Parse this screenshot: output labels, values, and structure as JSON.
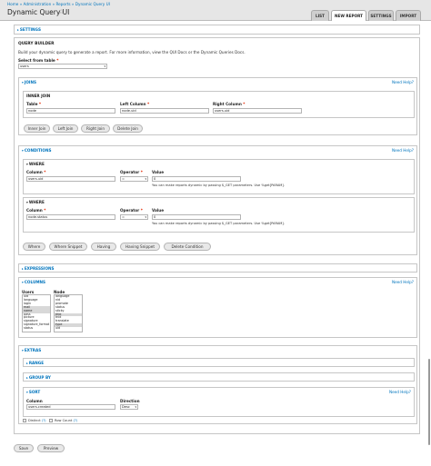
{
  "header": {
    "breadcrumb": "Home » Administration » Reports » Dynamic Query UI",
    "title": "Dynamic Query UI",
    "tabs": [
      "LIST",
      "NEW REPORT",
      "SETTINGS",
      "IMPORT"
    ]
  },
  "settings": {
    "legend": "SETTINGS"
  },
  "query_builder": {
    "title": "QUERY BUILDER",
    "intro": "Build your dynamic query to generate a report. For more information, view the QUI Docs or the Dynamic Queries Docs.",
    "select_label": "Select from table",
    "select_value": "users"
  },
  "joins": {
    "legend": "JOINS",
    "help": "Need Help?",
    "inner_join": {
      "legend": "INNER JOIN",
      "table_label": "Table",
      "left_label": "Left Column",
      "right_label": "Right Column",
      "table_value": "node",
      "left_value": "node.uid",
      "right_value": "users.uid"
    },
    "buttons": [
      "Inner Join",
      "Left Join",
      "Right Join",
      "Delete Join"
    ]
  },
  "conditions": {
    "legend": "CONDITIONS",
    "help": "Need Help?",
    "where1": {
      "legend": "WHERE",
      "column_label": "Column",
      "operator_label": "Operator",
      "value_label": "Value",
      "column_value": "users.uid",
      "operator_value": "=",
      "value_value": "0",
      "hint": "You can make reports dynamic by passing $_GET parameters. Use %get[PARAM]."
    },
    "where2": {
      "legend": "WHERE",
      "column_label": "Column",
      "operator_label": "Operator",
      "value_label": "Value",
      "column_value": "node.status",
      "operator_value": "=",
      "value_value": "0",
      "hint": "You can make reports dynamic by passing $_GET parameters. Use %get[PARAM]."
    },
    "buttons": [
      "Where",
      "Where Snippet",
      "Having",
      "Having Snippet",
      "Delete Condition"
    ]
  },
  "expressions": {
    "legend": "EXPRESSIONS"
  },
  "columns": {
    "legend": "COLUMNS",
    "help": "Need Help?",
    "users_label": "Users",
    "node_label": "Node",
    "users_options": [
      "uid",
      "language",
      "login",
      "mail",
      "name",
      "pass",
      "picture",
      "signature",
      "signature_format",
      "status"
    ],
    "users_selected": [
      3,
      4
    ],
    "node_options": [
      "language",
      "nid",
      "promote",
      "status",
      "sticky",
      "title",
      "tnid",
      "translate",
      "type",
      "uid"
    ],
    "node_selected": [
      5,
      8
    ]
  },
  "extras": {
    "legend": "EXTRAS",
    "range_legend": "RANGE",
    "group_by_legend": "GROUP BY",
    "sort": {
      "legend": "SORT",
      "help": "Need Help?",
      "column_label": "Column",
      "direction_label": "Direction",
      "column_value": "users.created",
      "direction_value": "Desc"
    },
    "distinct_label": "Distinct",
    "row_count_label": "Row Count",
    "info_marker": "(?)"
  },
  "actions": {
    "save": "Save",
    "preview": "Preview"
  },
  "colors": {
    "link": "#0074bd",
    "required": "#e32700",
    "header_bg": "#e6e6e6"
  }
}
